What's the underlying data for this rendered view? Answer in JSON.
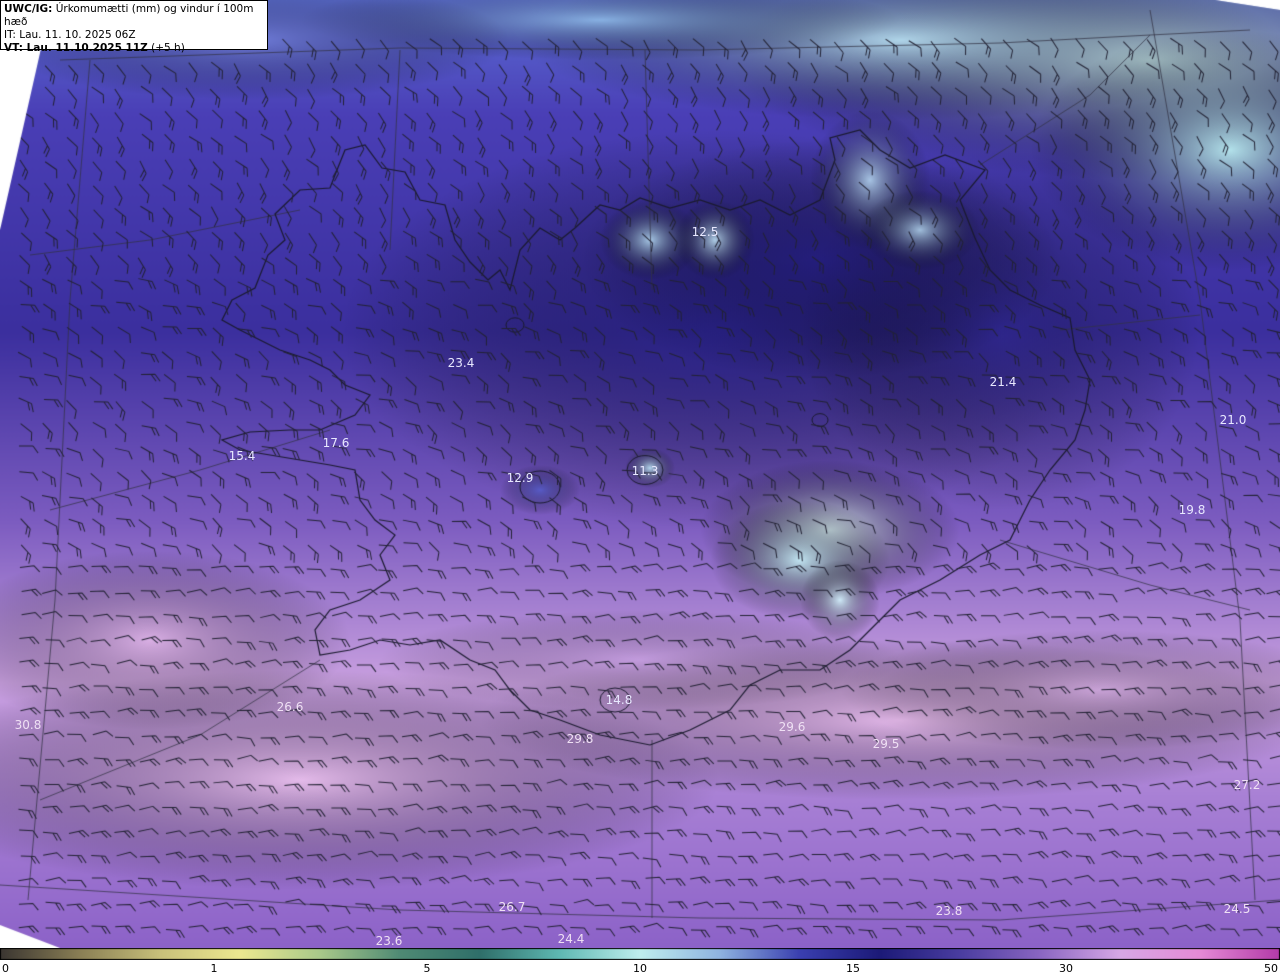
{
  "header": {
    "product": "UWC/IG:",
    "description": "Úrkomumætti (mm) og vindur í 100m hæð",
    "initial_time": "IT: Lau. 11. 10. 2025 06Z",
    "valid_label": "VT: Lau. 11.10.2025 11Z",
    "valid_offset": "(+5 h)"
  },
  "colorbar": {
    "ticks": [
      "0",
      "1",
      "5",
      "10",
      "15",
      "30",
      "50"
    ],
    "colors": [
      "#3a3531",
      "#8a7f55",
      "#c8c07a",
      "#ece890",
      "#a9c98a",
      "#4f8a74",
      "#2f6f6a",
      "#5fb9b3",
      "#bfeeee",
      "#8fb3e0",
      "#3a3fb0",
      "#1c1a78",
      "#4a3da0",
      "#8a66c2",
      "#d7a8e6",
      "#e58ad6",
      "#b23aa8"
    ]
  },
  "value_labels": [
    {
      "text": "12.5"
    },
    {
      "text": "23.4"
    },
    {
      "text": "21.4"
    },
    {
      "text": "21.0"
    },
    {
      "text": "17.6"
    },
    {
      "text": "15.4"
    },
    {
      "text": "12.9"
    },
    {
      "text": "11.3"
    },
    {
      "text": "19.8"
    },
    {
      "text": "14.8"
    },
    {
      "text": "26.6"
    },
    {
      "text": "29.8"
    },
    {
      "text": "29.6"
    },
    {
      "text": "29.5"
    },
    {
      "text": "30.8"
    },
    {
      "text": "27.2"
    },
    {
      "text": "26.7"
    },
    {
      "text": "23.8"
    },
    {
      "text": "24.5"
    },
    {
      "text": "23.6"
    },
    {
      "text": "24.4"
    }
  ],
  "colors": {
    "land_outline": "#1a1a2e",
    "barb": "#222233",
    "grid_line": "#333344"
  }
}
